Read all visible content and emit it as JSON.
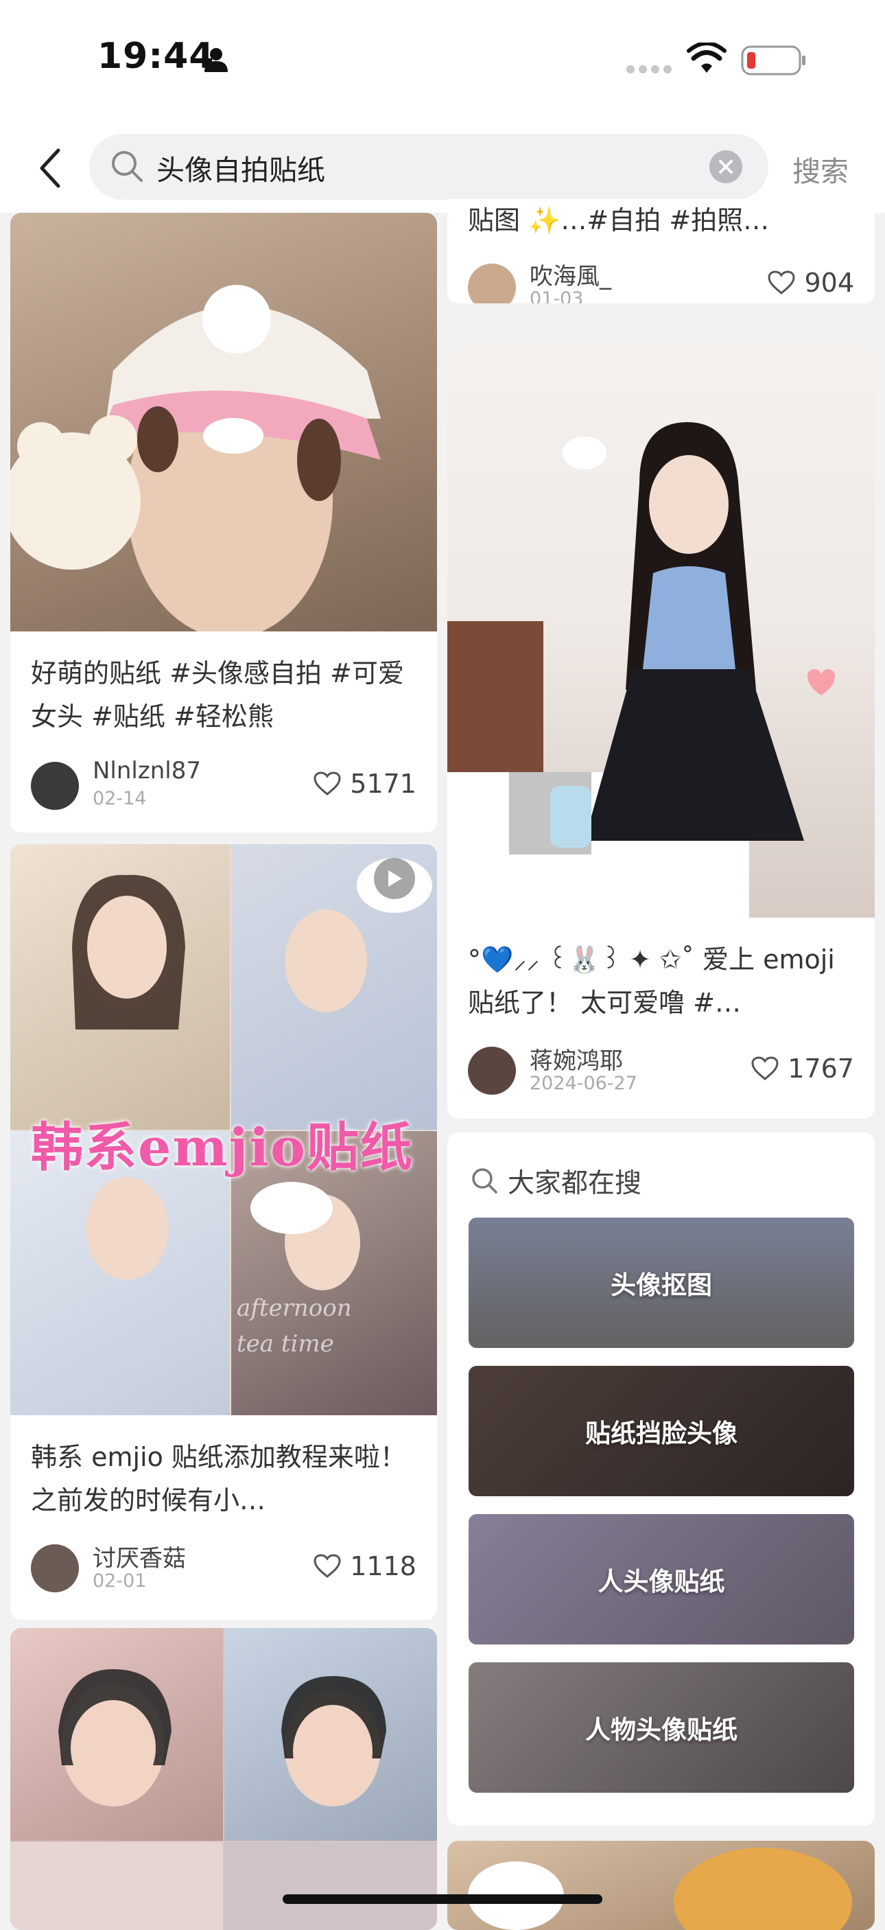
{
  "status_bar": {
    "time": "19:44"
  },
  "search": {
    "query": "头像自拍贴纸",
    "button_label": "搜索"
  },
  "colors": {
    "accent_pink": "#f05aa8",
    "heart_outline": "#555555",
    "search_bg": "#f1f1f3"
  },
  "left_column": [
    {
      "title": "好萌的贴纸 #头像感自拍  #可爱女头  #贴纸  #轻松熊",
      "author": "Nlnlznl87",
      "date": "02-14",
      "likes": "5171"
    },
    {
      "title": "韩系 emjio 贴纸添加教程来啦！ 之前发的时候有小…",
      "image_text": "韩系emjio贴纸",
      "image_watermark": "afternoon tea time",
      "author": "讨厌香菇",
      "date": "02-01",
      "likes": "1118"
    }
  ],
  "right_column": [
    {
      "title": "贴图 ✨…#自拍  #拍照…",
      "author": "吹海風_",
      "date": "01-03",
      "likes": "904"
    },
    {
      "title": "°💙⸝⸝ ꒰🐰꒱ ✦ ✩˚ 爱上 emoji 贴纸了！  太可爱噜 #…",
      "author": "蒋婉鸿耶",
      "date": "2024-06-27",
      "likes": "1767"
    }
  ],
  "suggestions": {
    "heading": "大家都在搜",
    "items": [
      "头像抠图",
      "贴纸挡脸头像",
      "人头像贴纸",
      "人物头像贴纸"
    ]
  }
}
